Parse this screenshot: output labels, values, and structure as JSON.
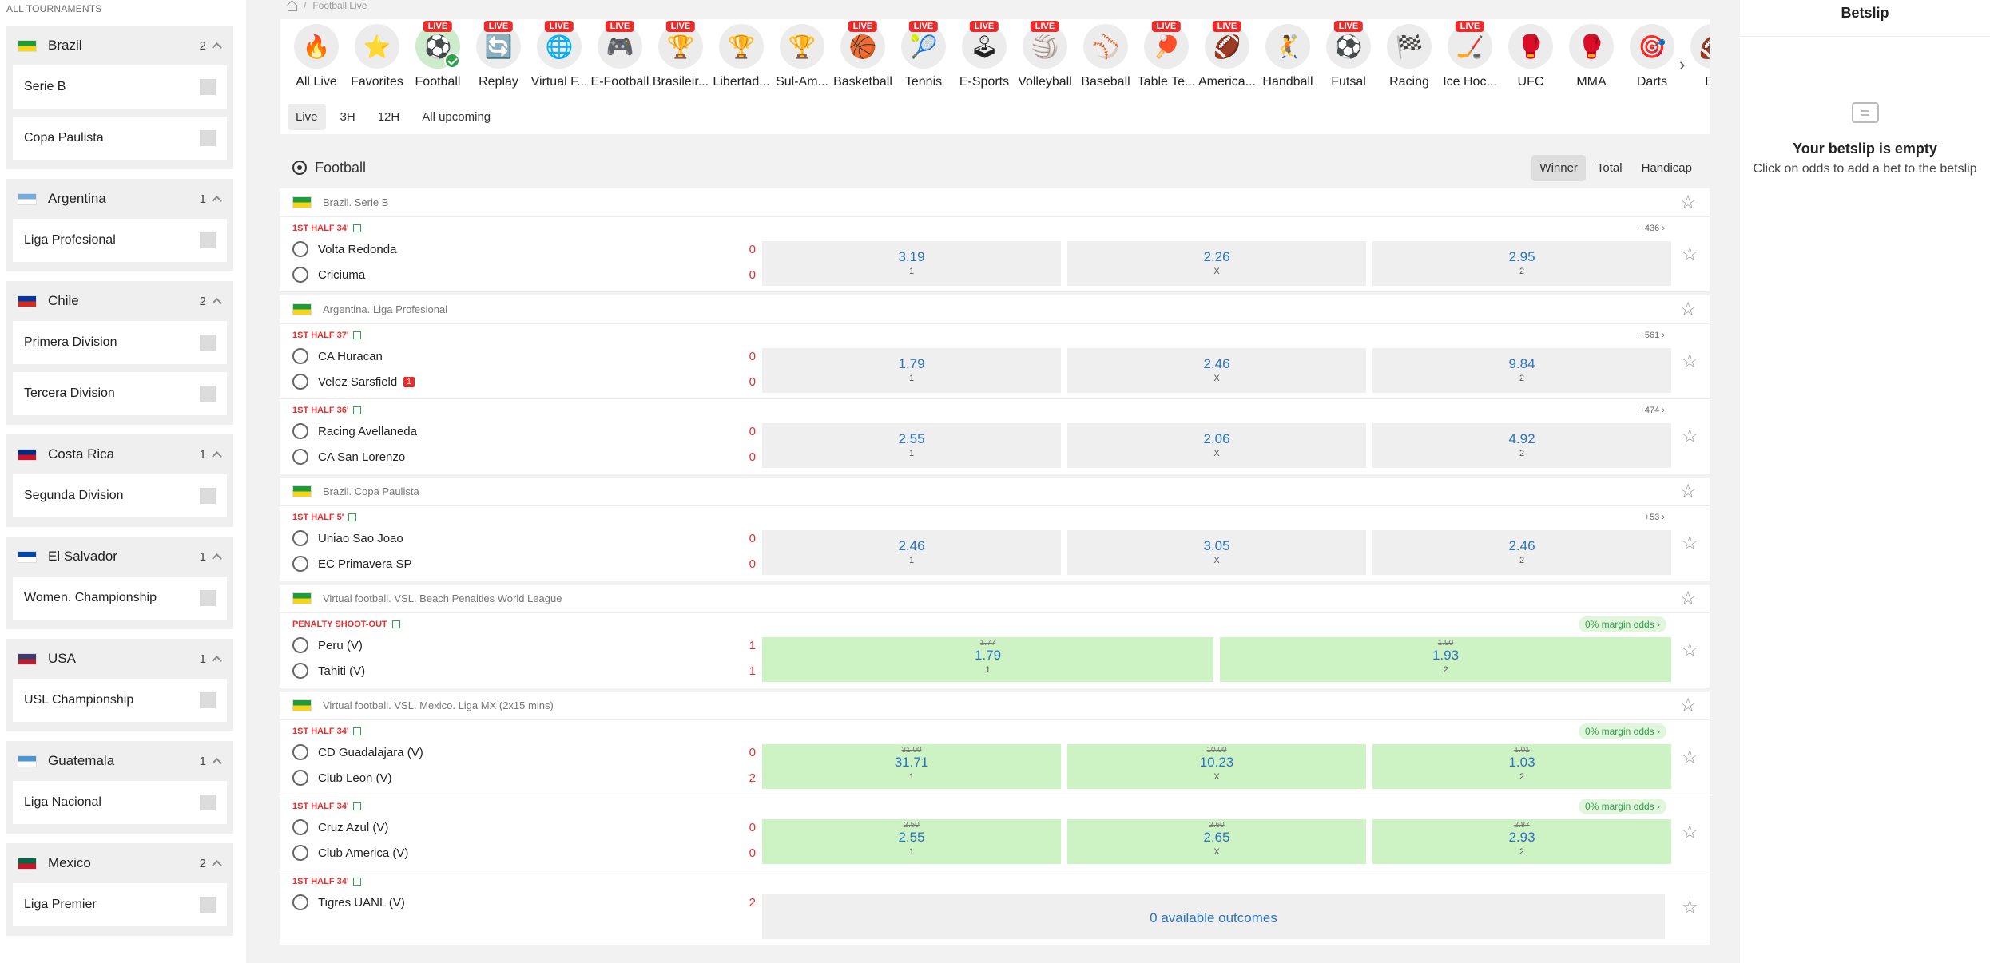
{
  "sidebar": {
    "title": "ALL TOURNAMENTS",
    "countries": [
      {
        "name": "Brazil",
        "count": "2",
        "flag": [
          "#1b9e3a",
          "#f7d417"
        ],
        "leagues": [
          "Serie B",
          "Copa Paulista"
        ]
      },
      {
        "name": "Argentina",
        "count": "1",
        "flag": [
          "#74acdf",
          "#ffffff"
        ],
        "leagues": [
          "Liga Profesional"
        ]
      },
      {
        "name": "Chile",
        "count": "2",
        "flag": [
          "#0039a6",
          "#d52b1e"
        ],
        "leagues": [
          "Primera Division",
          "Tercera Division"
        ]
      },
      {
        "name": "Costa Rica",
        "count": "1",
        "flag": [
          "#002b7f",
          "#ce1126"
        ],
        "leagues": [
          "Segunda Division"
        ]
      },
      {
        "name": "El Salvador",
        "count": "1",
        "flag": [
          "#0047ab",
          "#ffffff"
        ],
        "leagues": [
          "Women. Championship"
        ]
      },
      {
        "name": "USA",
        "count": "1",
        "flag": [
          "#3c3b6e",
          "#b22234"
        ],
        "leagues": [
          "USL Championship"
        ]
      },
      {
        "name": "Guatemala",
        "count": "1",
        "flag": [
          "#4997d0",
          "#ffffff"
        ],
        "leagues": [
          "Liga Nacional"
        ]
      },
      {
        "name": "Mexico",
        "count": "2",
        "flag": [
          "#006847",
          "#ce1126"
        ],
        "leagues": [
          "Liga Premier"
        ]
      }
    ]
  },
  "breadcrumb": {
    "current": "Football Live"
  },
  "sports": [
    {
      "label": "All Live",
      "icon": "🔥",
      "live": false,
      "active": false
    },
    {
      "label": "Favorites",
      "icon": "⭐",
      "live": false,
      "active": false
    },
    {
      "label": "Football",
      "icon": "⚽",
      "live": true,
      "active": true
    },
    {
      "label": "Replay",
      "icon": "🔄",
      "live": true,
      "active": false
    },
    {
      "label": "Virtual F...",
      "icon": "🌐",
      "live": true,
      "active": false
    },
    {
      "label": "E-Football",
      "icon": "🎮",
      "live": true,
      "active": false
    },
    {
      "label": "Brasileir...",
      "icon": "🏆",
      "live": true,
      "active": false
    },
    {
      "label": "Libertad...",
      "icon": "🏆",
      "live": false,
      "active": false
    },
    {
      "label": "Sul-Am...",
      "icon": "🏆",
      "live": false,
      "active": false
    },
    {
      "label": "Basketball",
      "icon": "🏀",
      "live": true,
      "active": false
    },
    {
      "label": "Tennis",
      "icon": "🎾",
      "live": true,
      "active": false
    },
    {
      "label": "E-Sports",
      "icon": "🕹",
      "live": true,
      "active": false
    },
    {
      "label": "Volleyball",
      "icon": "🏐",
      "live": true,
      "active": false
    },
    {
      "label": "Baseball",
      "icon": "⚾",
      "live": false,
      "active": false
    },
    {
      "label": "Table Te...",
      "icon": "🏓",
      "live": true,
      "active": false
    },
    {
      "label": "America...",
      "icon": "🏈",
      "live": true,
      "active": false
    },
    {
      "label": "Handball",
      "icon": "🤾",
      "live": false,
      "active": false
    },
    {
      "label": "Futsal",
      "icon": "⚽",
      "live": true,
      "active": false
    },
    {
      "label": "Racing",
      "icon": "🏁",
      "live": false,
      "active": false
    },
    {
      "label": "Ice Hoc...",
      "icon": "🏒",
      "live": true,
      "active": false
    },
    {
      "label": "UFC",
      "icon": "🥊",
      "live": false,
      "active": false
    },
    {
      "label": "MMA",
      "icon": "🥊",
      "live": false,
      "active": false
    },
    {
      "label": "Darts",
      "icon": "🎯",
      "live": false,
      "active": false
    },
    {
      "label": "Bo",
      "icon": "🏈",
      "live": false,
      "active": false
    }
  ],
  "time_filters": [
    "Live",
    "3H",
    "12H",
    "All upcoming"
  ],
  "feed": {
    "title": "Football",
    "market_tabs": [
      "Winner",
      "Total",
      "Handicap"
    ]
  },
  "groups": [
    {
      "league": "Brazil. Serie B",
      "matches": [
        {
          "status": "1ST HALF 34'",
          "more": "+436 ›",
          "home": "Volta Redonda",
          "away": "Criciuma",
          "hs": "0",
          "as": "0",
          "odds": [
            {
              "v": "3.19",
              "l": "1"
            },
            {
              "v": "2.26",
              "l": "X"
            },
            {
              "v": "2.95",
              "l": "2"
            }
          ]
        }
      ]
    },
    {
      "league": "Argentina. Liga Profesional",
      "matches": [
        {
          "status": "1ST HALF 37'",
          "more": "+561 ›",
          "home": "CA Huracan",
          "away": "Velez Sarsfield",
          "redcard": "1",
          "hs": "0",
          "as": "0",
          "odds": [
            {
              "v": "1.79",
              "l": "1"
            },
            {
              "v": "2.46",
              "l": "X"
            },
            {
              "v": "9.84",
              "l": "2"
            }
          ]
        },
        {
          "status": "1ST HALF 36'",
          "more": "+474 ›",
          "home": "Racing Avellaneda",
          "away": "CA San Lorenzo",
          "hs": "0",
          "as": "0",
          "odds": [
            {
              "v": "2.55",
              "l": "1"
            },
            {
              "v": "2.06",
              "l": "X"
            },
            {
              "v": "4.92",
              "l": "2"
            }
          ]
        }
      ]
    },
    {
      "league": "Brazil. Copa Paulista",
      "matches": [
        {
          "status": "1ST HALF 5'",
          "more": "+53 ›",
          "home": "Uniao Sao Joao",
          "away": "EC Primavera SP",
          "hs": "0",
          "as": "0",
          "odds": [
            {
              "v": "2.46",
              "l": "1"
            },
            {
              "v": "3.05",
              "l": "X"
            },
            {
              "v": "2.46",
              "l": "2"
            }
          ]
        }
      ]
    },
    {
      "league": "Virtual football. VSL. Beach Penalties World League",
      "matches": [
        {
          "status": "PENALTY SHOOT-OUT",
          "margin": "0% margin odds ›",
          "home": "Peru (V)",
          "away": "Tahiti (V)",
          "hs": "1",
          "as": "1",
          "two": true,
          "odds": [
            {
              "v": "1.79",
              "l": "1",
              "old": "1.77"
            },
            {
              "v": "1.93",
              "l": "2",
              "old": "1.90"
            }
          ]
        }
      ]
    },
    {
      "league": "Virtual football. VSL. Mexico. Liga MX (2x15 mins)",
      "matches": [
        {
          "status": "1ST HALF 34'",
          "margin": "0% margin odds ›",
          "home": "CD Guadalajara (V)",
          "away": "Club Leon (V)",
          "hs": "0",
          "as": "2",
          "odds": [
            {
              "v": "31.71",
              "l": "1",
              "old": "31.00"
            },
            {
              "v": "10.23",
              "l": "X",
              "old": "10.00"
            },
            {
              "v": "1.03",
              "l": "2",
              "old": "1.01"
            }
          ]
        },
        {
          "status": "1ST HALF 34'",
          "margin": "0% margin odds ›",
          "home": "Cruz Azul (V)",
          "away": "Club America (V)",
          "hs": "0",
          "as": "0",
          "odds": [
            {
              "v": "2.55",
              "l": "1",
              "old": "2.50"
            },
            {
              "v": "2.65",
              "l": "X",
              "old": "2.60"
            },
            {
              "v": "2.93",
              "l": "2",
              "old": "2.87"
            }
          ]
        },
        {
          "status": "1ST HALF 34'",
          "home": "Tigres UANL (V)",
          "away": "",
          "hs": "2",
          "as": "",
          "unavailable": "0 available outcomes"
        }
      ]
    }
  ],
  "betslip": {
    "title": "Betslip",
    "empty": "Your betslip is empty",
    "hint": "Click on odds to add a bet to the betslip"
  }
}
